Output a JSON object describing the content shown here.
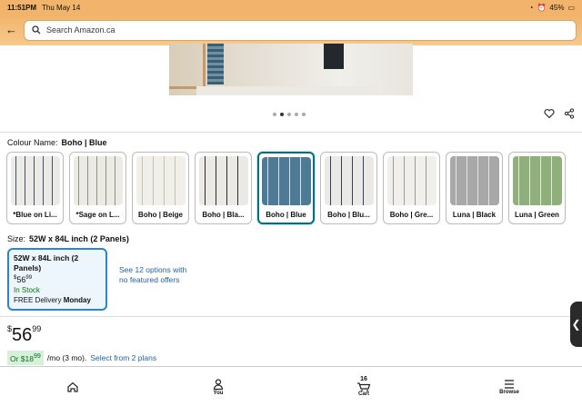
{
  "status_bar": {
    "time": "11:51PM",
    "date": "Thu May 14",
    "battery": "45%"
  },
  "header": {
    "search_placeholder": "Search Amazon.ca"
  },
  "carousel": {
    "dots": 5,
    "active_index": 1
  },
  "colour": {
    "label": "Colour Name:",
    "value": "Boho | Blue",
    "swatches": [
      {
        "label": "*Blue on Li..."
      },
      {
        "label": "*Sage on L..."
      },
      {
        "label": "Boho | Beige"
      },
      {
        "label": "Boho | Bla..."
      },
      {
        "label": "Boho | Blue"
      },
      {
        "label": "Boho | Blu..."
      },
      {
        "label": "Boho | Gre..."
      },
      {
        "label": "Luna | Black"
      },
      {
        "label": "Luna | Green"
      }
    ]
  },
  "size": {
    "label": "Size:",
    "value": "52W x 84L inch (2 Panels)",
    "option": {
      "title": "52W x 84L inch (2 Panels)",
      "price_symbol": "$",
      "price_whole": "56",
      "price_fraction": "99",
      "stock": "In Stock",
      "delivery_prefix": "FREE Delivery",
      "delivery_day": "Monday"
    },
    "see_options": "See 12 options with no featured offers"
  },
  "price": {
    "symbol": "$",
    "whole": "56",
    "fraction": "99"
  },
  "plan": {
    "prefix": "Or $",
    "whole": "18",
    "fraction": "99",
    "suffix": "/mo (3 mo).",
    "link": "Select from 2 plans"
  },
  "nav": {
    "you": "You",
    "cart": "Cart",
    "cart_count": "16",
    "browse": "Browse"
  }
}
